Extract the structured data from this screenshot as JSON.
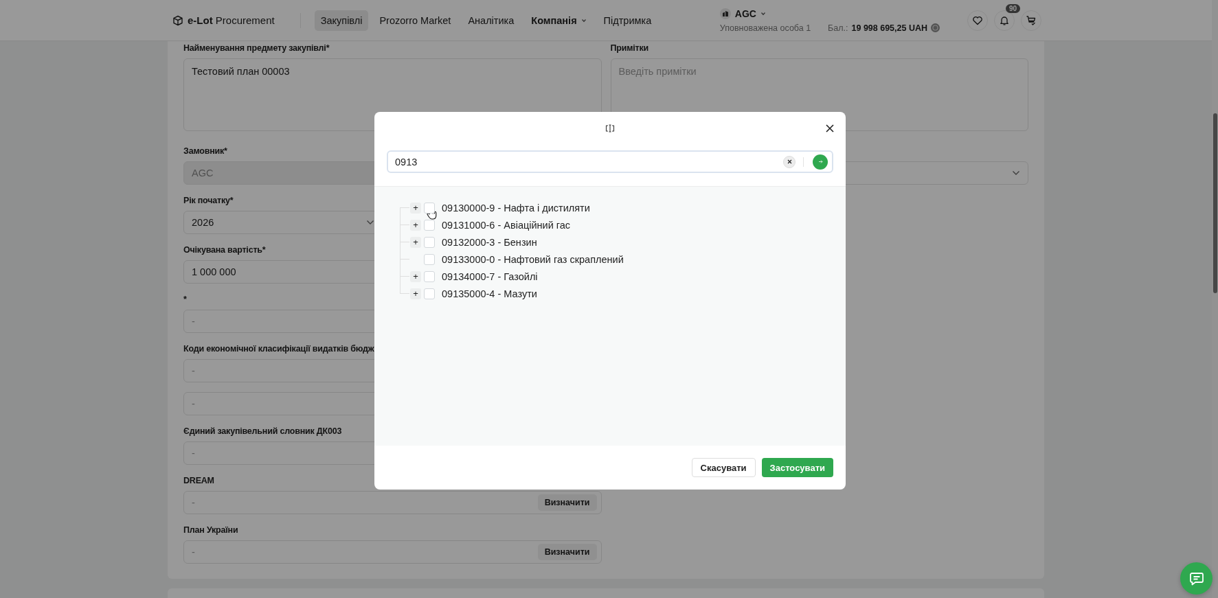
{
  "header": {
    "logo": "**e-Lot** Procurement",
    "nav": [
      {
        "label": "Закупівлі",
        "selected": true,
        "dropdown": false
      },
      {
        "label": "Prozorro Market",
        "selected": false,
        "dropdown": false
      },
      {
        "label": "Аналітика",
        "selected": false,
        "dropdown": false
      },
      {
        "label": "Компанія",
        "selected": false,
        "dropdown": true
      },
      {
        "label": "Підтримка",
        "selected": false,
        "dropdown": false
      }
    ],
    "account": {
      "organization": "AGC",
      "user": "Уповноважена особа 1",
      "balance_label": "Бал.:",
      "balance": "19 998 695,25 UAH"
    },
    "notifications_count": "90"
  },
  "form": {
    "rows": [
      {
        "fields": [
          {
            "kind": "textarea",
            "label": "Найменування предмету закупівлі*",
            "value": "Тестовий план 00003"
          },
          {
            "kind": "textarea",
            "label": "Примітки",
            "placeholder": "Введіть примітки"
          }
        ]
      },
      {
        "fields": [
          {
            "kind": "input",
            "label": "Замовник*",
            "value": "AGC",
            "disabled": true
          },
          {
            "kind": "select"
          }
        ]
      },
      {
        "fields": [
          {
            "kind": "select",
            "label": "Рік початку*",
            "value": "2026"
          }
        ]
      },
      {
        "fields": [
          {
            "kind": "input",
            "label": "Очікувана вартість*",
            "value": "1 000 000"
          }
        ]
      },
      {
        "fields": [
          {
            "kind": "input",
            "label": "*",
            "placeholder": "-"
          }
        ]
      },
      {
        "fields": [
          {
            "kind": "input",
            "label": "Коди економічної класифікації видатків бюдж",
            "placeholder": "-"
          }
        ]
      },
      {
        "fields": [
          {
            "kind": "input",
            "placeholder": "-"
          }
        ]
      },
      {
        "fields": [
          {
            "kind": "input",
            "label": "Єдиний закупівельний словник ДК003",
            "placeholder": "-"
          }
        ]
      },
      {
        "fields": [
          {
            "kind": "input-action",
            "label": "DREAM",
            "placeholder": "-",
            "action": "Визначити"
          }
        ]
      },
      {
        "fields": [
          {
            "kind": "input-action",
            "label": "План України",
            "placeholder": "-",
            "action": "Визначити"
          }
        ]
      }
    ]
  },
  "modal": {
    "search": {
      "value": "0913"
    },
    "tree": [
      {
        "expander": "+",
        "label": "09130000-9 - Нафта і дистиляти",
        "checked": false
      },
      {
        "expander": "+",
        "label": "09131000-6 - Авіаційний гас",
        "checked": false
      },
      {
        "expander": "+",
        "label": "09132000-3 - Бензин",
        "checked": false
      },
      {
        "label": "09133000-0 - Нафтовий газ скраплений",
        "checked": false
      },
      {
        "expander": "+",
        "label": "09134000-7 - Газойлі",
        "checked": false
      },
      {
        "expander": "+",
        "label": "09135000-4 - Мазути",
        "checked": false
      }
    ],
    "buttons": [
      {
        "kind": "secondary",
        "label": "Скасувати"
      },
      {
        "kind": "primary",
        "label": "Застосувати"
      }
    ]
  }
}
